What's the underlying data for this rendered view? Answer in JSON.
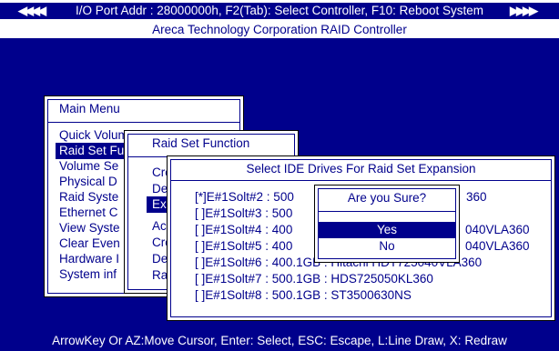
{
  "header": {
    "arrows_left": "◀◀◀◀",
    "arrows_right": "▶▶▶▶",
    "line1": "I/O Port Addr : 28000000h, F2(Tab): Select Controller, F10: Reboot System",
    "line2": "Areca Technology Corporation RAID Controller"
  },
  "main_menu": {
    "title": "Main Menu",
    "items": [
      "Quick Volume/Raid Setup",
      "Raid Set Function",
      "Volume Se",
      "Physical D",
      "Raid Syste",
      "Ethernet C",
      "View Syste",
      "Clear Even",
      "Hardware I",
      "System inf"
    ],
    "selected_index": 1
  },
  "raidset_menu": {
    "title": "Raid Set Function",
    "items": [
      "Cre",
      "Del",
      "Exp",
      "Act",
      "Cre",
      "Del",
      "Rai"
    ],
    "selected_index": 2
  },
  "drives_window": {
    "title": "Select IDE Drives For Raid Set Expansion",
    "rows": [
      {
        "text": "[*]E#1Solt#2 : 500",
        "tail": "360"
      },
      {
        "text": "[  ]E#1Solt#3 : 500",
        "tail": ""
      },
      {
        "text": "[  ]E#1Solt#4 : 400",
        "tail": "040VLA360"
      },
      {
        "text": "[  ]E#1Solt#5 : 400",
        "tail": "040VLA360"
      },
      {
        "text": "[  ]E#1Solt#6 : 400.1GB : Hitachi HDT725040VLA360",
        "tail": ""
      },
      {
        "text": "[  ]E#1Solt#7 : 500.1GB : HDS725050KL360",
        "tail": ""
      },
      {
        "text": "[  ]E#1Solt#8 : 500.1GB : ST3500630NS",
        "tail": ""
      }
    ]
  },
  "confirm_dialog": {
    "title": "Are you Sure?",
    "yes": "Yes",
    "no": "No",
    "selected": "Yes"
  },
  "footer": {
    "help": "ArrowKey Or AZ:Move Cursor, Enter: Select, ESC: Escape, L:Line Draw, X: Redraw"
  },
  "colors": {
    "background": "#00008c",
    "window": "#ffffff",
    "text": "#00008c",
    "selection": "#00008c"
  }
}
